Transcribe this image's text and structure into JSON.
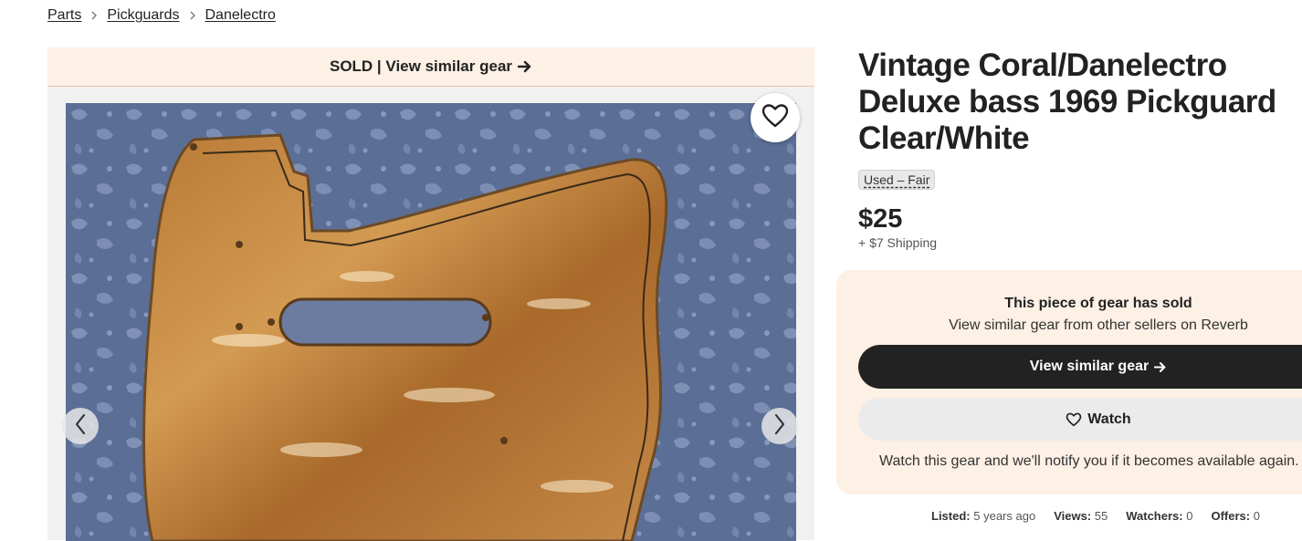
{
  "breadcrumb": {
    "items": [
      "Parts",
      "Pickguards",
      "Danelectro"
    ]
  },
  "gallery": {
    "sold_banner": "SOLD | View similar gear",
    "icons": {
      "favorite": "heart-outline-icon",
      "prev": "chevron-left-icon",
      "next": "chevron-right-icon"
    }
  },
  "listing": {
    "title": "Vintage Coral/Danelectro Deluxe bass 1969 Pickguard Clear/White",
    "condition": "Used – Fair",
    "price": "$25",
    "shipping": "+ $7 Shipping"
  },
  "sold_card": {
    "heading": "This piece of gear has sold",
    "subtext": "View similar gear from other sellers on Reverb",
    "similar_button": "View similar gear",
    "watch_button": "Watch",
    "watch_note": "Watch this gear and we'll notify you if it becomes available again."
  },
  "stats": {
    "listed_label": "Listed:",
    "listed_value": "5 years ago",
    "views_label": "Views:",
    "views_value": "55",
    "watchers_label": "Watchers:",
    "watchers_value": "0",
    "offers_label": "Offers:",
    "offers_value": "0"
  },
  "colors": {
    "sold_bg": "#fdf0e5",
    "primary_button": "#222222",
    "secondary_button": "#ebebeb"
  }
}
